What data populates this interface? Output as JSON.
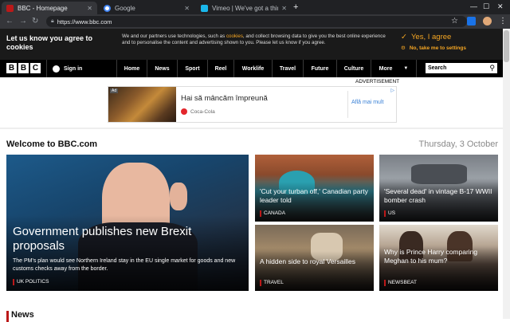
{
  "browser": {
    "tabs": [
      {
        "title": "BBC - Homepage",
        "favicon": "bbc-favicon",
        "color": "#bb1919",
        "active": true
      },
      {
        "title": "Google",
        "favicon": "google-favicon",
        "color": "#4285f4",
        "active": false
      },
      {
        "title": "Vimeo | We've got a thing for vid",
        "favicon": "vimeo-favicon",
        "color": "#1ab7ea",
        "active": false
      }
    ],
    "url": "https://www.bbc.com",
    "icons": [
      "back-arrow-icon",
      "forward-arrow-icon",
      "reload-icon",
      "star-icon",
      "extension-icon",
      "profile-icon",
      "menu-icon"
    ]
  },
  "cookie_banner": {
    "title": "Let us know you agree to cookies",
    "text_before": "We and our partners use technologies, such as ",
    "text_highlight": "cookies",
    "text_after": ", and collect browsing data to give you the best online experience and to personalise the content and advertising shown to you. Please let us know if you agree.",
    "yes_label": "Yes, I agree",
    "no_label": "No, take me to settings",
    "accent": "#f5a623"
  },
  "nav": {
    "logo_letters": [
      "B",
      "B",
      "C"
    ],
    "signin_label": "Sign in",
    "items": [
      "Home",
      "News",
      "Sport",
      "Reel",
      "Worklife",
      "Travel",
      "Future",
      "Culture",
      "More"
    ],
    "search_value": "Search"
  },
  "ad": {
    "label": "ADVERTISEMENT",
    "tag": "Ad",
    "headline": "Hai să mâncăm împreună",
    "brand": "Coca-Cola",
    "cta": "Află mai mult"
  },
  "section": {
    "welcome": "Welcome to BBC.com",
    "date": "Thursday, 3 October"
  },
  "stories": {
    "main": {
      "headline": "Government publishes new Brexit proposals",
      "summary": "The PM's plan would see Northern Ireland stay in the EU single market for goods and new customs checks away from the border.",
      "tag": "UK POLITICS"
    },
    "grid": [
      {
        "headline": "'Cut your turban off,' Canadian party leader told",
        "tag": "CANADA"
      },
      {
        "headline": "'Several dead' in vintage B-17 WWII bomber crash",
        "tag": "US"
      },
      {
        "headline": "A hidden side to royal Versailles",
        "tag": "TRAVEL"
      },
      {
        "headline": "Why is Prince Harry comparing Meghan to his mum?",
        "tag": "NEWSBEAT"
      }
    ]
  },
  "news_heading": "News",
  "colors": {
    "bbc_red": "#bb1919",
    "nav_bg": "#000000"
  }
}
